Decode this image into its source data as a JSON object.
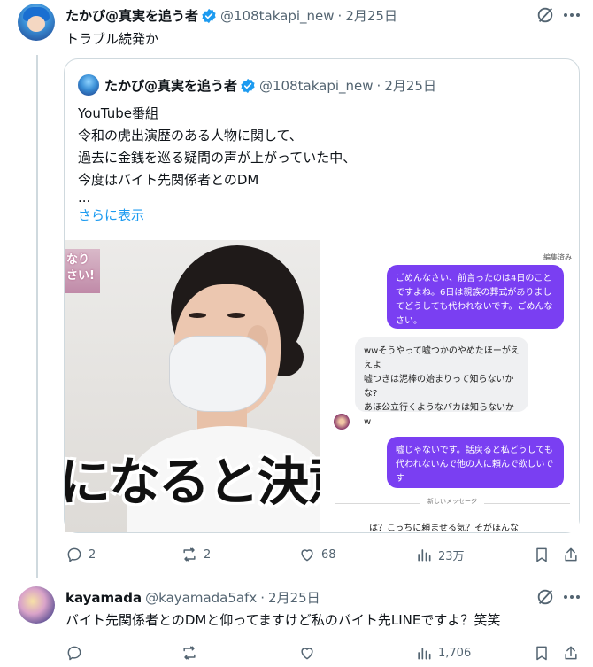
{
  "main_tweet": {
    "author_name": "たかぴ@真実を追う者",
    "handle": "@108takapi_new",
    "separator": "·",
    "date": "2月25日",
    "text": "トラブル続発か",
    "icons": {
      "verified": "verified-badge-icon",
      "grok": "grok-icon",
      "more": "more-icon"
    },
    "accent_color": "#1d9bf0",
    "quoted": {
      "author_name": "たかぴ@真実を追う者",
      "handle": "@108takapi_new",
      "separator": "·",
      "date": "2月25日",
      "lines": [
        "YouTube番組",
        "令和の虎出演歴のある人物に関して、",
        "過去に金銭を巡る疑問の声が上がっていた中、",
        "今度はバイト先関係者とのDM",
        "..."
      ],
      "show_more": "さらに表示",
      "media": {
        "left_overlay_text": "なり\nさい!",
        "left_caption": "になると決意",
        "right_chat": {
          "edited_label": "編集済み",
          "messages": [
            "ごめんなさい、前言ったのは4日のことですよね。6日は親族の葬式がありましてどうしても代われないです。ごめんなさい。",
            "wwそうやって嘘つかのやめたほーがええよ\n嘘つきは泥棒の始まりって知らないかな?\nあほ公立行くようなバカは知らないかw",
            "嘘じゃないです。話戻ると私どうしても代われないんで他の人に頼んで欲しいです"
          ],
          "divider_label": "新しいメッセージ",
          "cut_text": "は？こっちに頼ませる気？そがほんな"
        }
      }
    },
    "stats": {
      "replies": "2",
      "reposts": "2",
      "likes": "68",
      "views": "23万"
    }
  },
  "reply_tweet": {
    "author_name": "kayamada",
    "handle": "@kayamada5afx",
    "separator": "·",
    "date": "2月25日",
    "text": "バイト先関係者とのDMと仰ってますけど私のバイト先LINEですよ？笑笑",
    "stats": {
      "views": "1,706"
    }
  }
}
